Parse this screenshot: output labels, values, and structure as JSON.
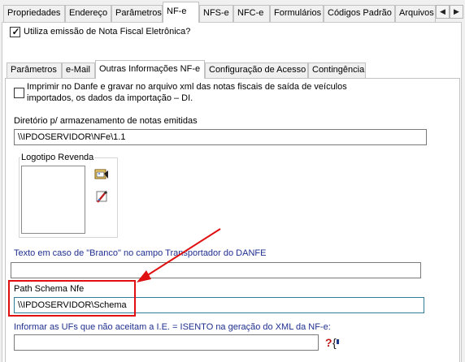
{
  "top_tabs": [
    "Propriedades",
    "Endereço",
    "Parâmetros",
    "NF-e",
    "NFS-e",
    "NFC-e",
    "Formulários",
    "Códigos Padrão",
    "Arquivos"
  ],
  "nfe_checkbox": {
    "label": "Utiliza emissão de Nota Fiscal Eletrônica?",
    "checked": true
  },
  "inner_tabs": [
    "Parâmetros",
    "e-Mail",
    "Outras Informações NF-e",
    "Configuração de Acesso",
    "Contingência"
  ],
  "print_checkbox": {
    "line1": "Imprimir no Danfe e gravar no arquivo xml das notas fiscais de saída de veículos",
    "line2": "importados, os dados da importação – DI.",
    "checked": false
  },
  "directory": {
    "label": "Diretório p/ armazenamento de notas emitidas",
    "value": "\\\\IPDOSERVIDOR\\NFe\\1.1"
  },
  "logo": {
    "label": "Logotipo Revenda"
  },
  "branco": {
    "label": "Texto em caso de \"Branco\" no campo Transportador do DANFE",
    "value": ""
  },
  "schema": {
    "label": "Path Schema Nfe",
    "value": "\\\\IPDOSERVIDOR\\Schema"
  },
  "ufs": {
    "label": "Informar as UFs que não aceitam a I.E. = ISENTO na geração do XML da NF-e:",
    "value": ""
  },
  "colors": {
    "highlight": "#e01010",
    "label_blue": "#1f2f8f",
    "focus_border": "#2f7f9a"
  }
}
